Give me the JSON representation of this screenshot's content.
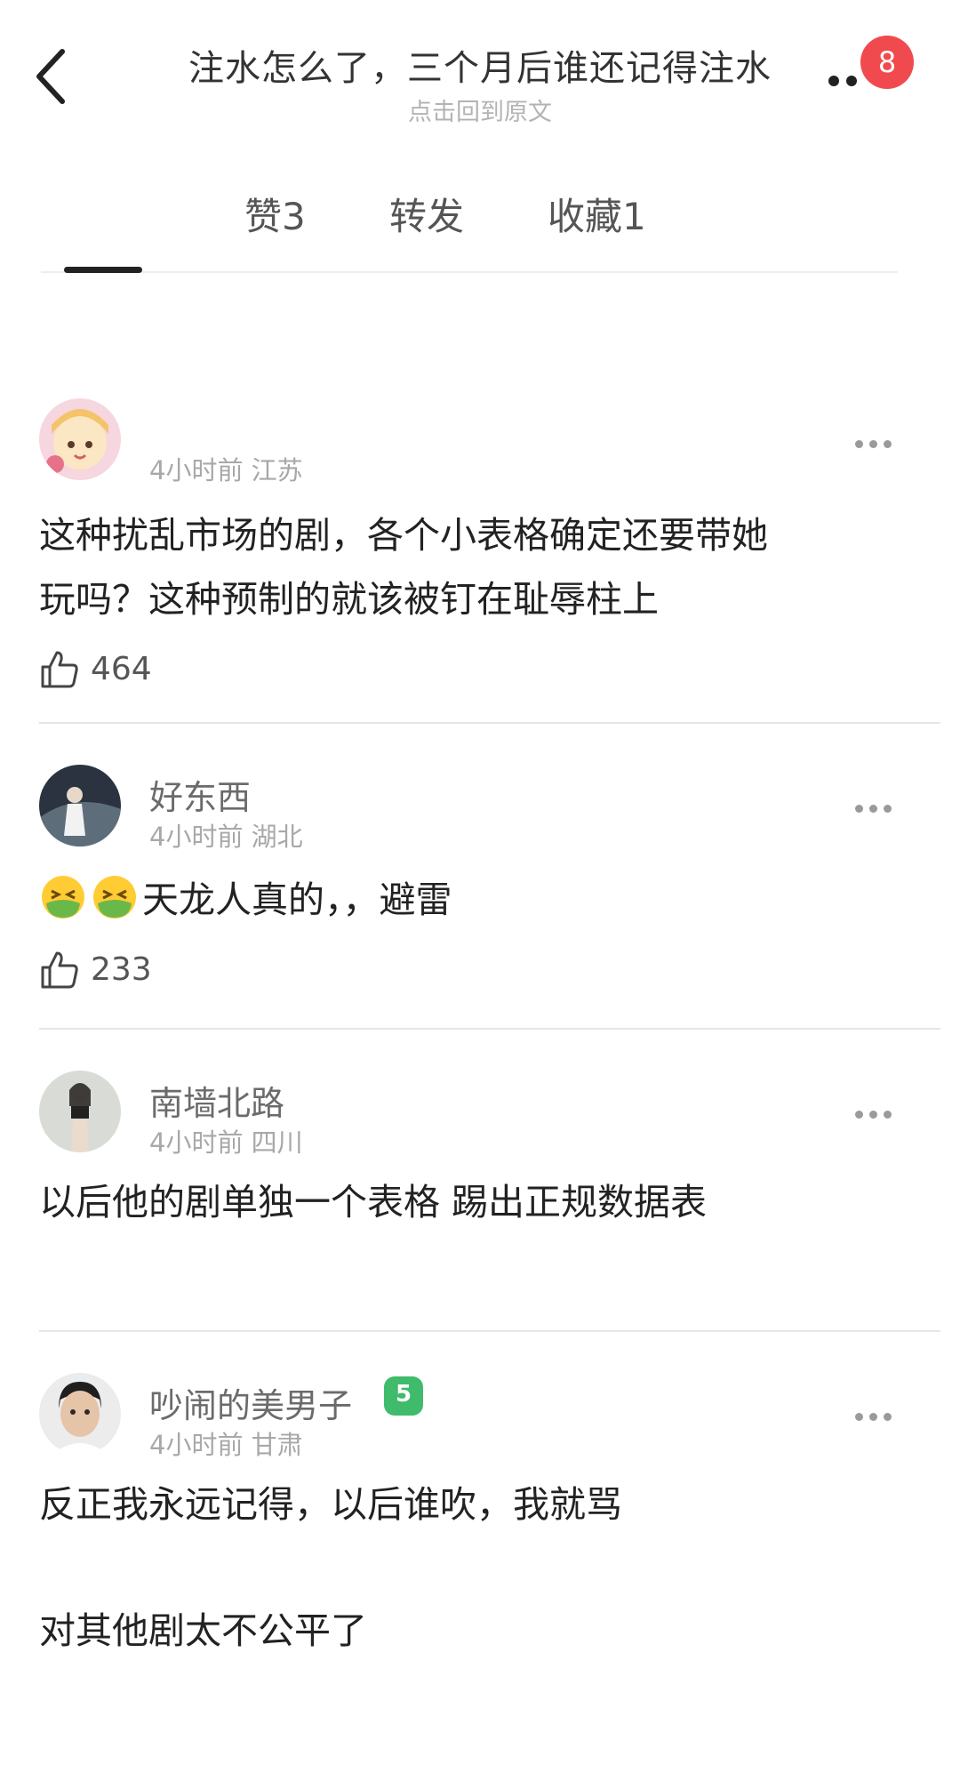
{
  "header": {
    "title": "注水怎么了，三个月后谁还记得注水",
    "subtitle": "点击回到原文",
    "notification_count": "8"
  },
  "tabs": [
    {
      "label": "赞3"
    },
    {
      "label": "转发"
    },
    {
      "label": "收藏1"
    }
  ],
  "comments": [
    {
      "username": "",
      "time": "4小时前 江苏",
      "text_line1": "这种扰乱市场的剧，各个小表格确定还要带她",
      "text_line2": "玩吗？这种预制的就该被钉在耻辱柱上",
      "likes": "464"
    },
    {
      "username": "好东西",
      "time": "4小时前 湖北",
      "text": "天龙人真的，，避雷",
      "emoji": "nauseated-face",
      "likes": "233"
    },
    {
      "username": "南墙北路",
      "time": "4小时前 四川",
      "text": "以后他的剧单独一个表格 踢出正规数据表"
    },
    {
      "username": "吵闹的美男子",
      "level": "5",
      "time": "4小时前 甘肃",
      "text_line1": "反正我永远记得，以后谁吹，我就骂",
      "text_line2": "对其他剧太不公平了"
    }
  ],
  "colors": {
    "badge": "#f04a4f",
    "level_badge": "#3fbb6b",
    "text_primary": "#222222",
    "text_secondary": "#a8a8a8"
  }
}
